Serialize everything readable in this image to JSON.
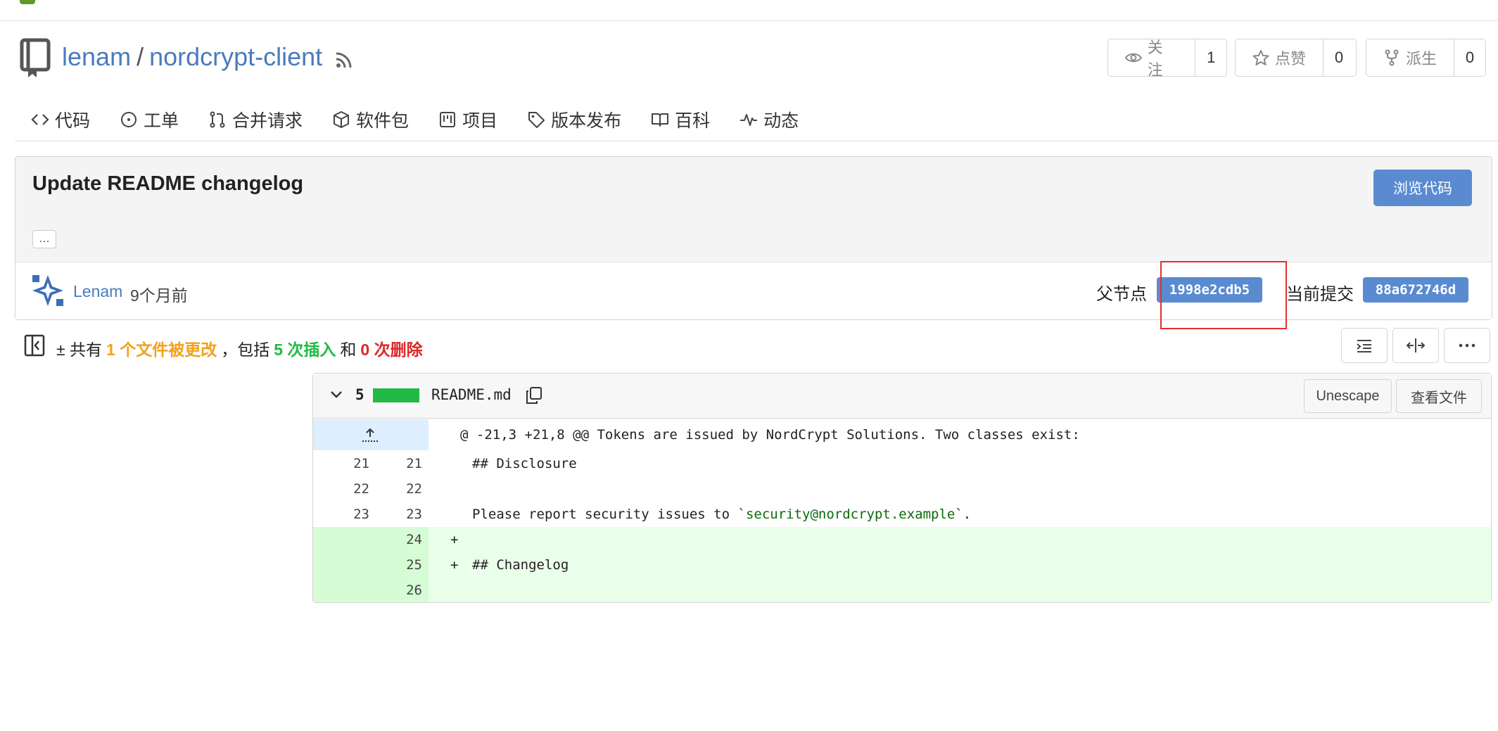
{
  "repo": {
    "owner": "lenam",
    "separator": "/",
    "name": "nordcrypt-client",
    "watch_label": "关注",
    "watch_count": "1",
    "star_label": "点赞",
    "star_count": "0",
    "fork_label": "派生",
    "fork_count": "0"
  },
  "tabs": [
    {
      "label": "代码",
      "icon": "code-icon"
    },
    {
      "label": "工单",
      "icon": "issue-icon"
    },
    {
      "label": "合并请求",
      "icon": "pull-request-icon"
    },
    {
      "label": "软件包",
      "icon": "package-icon"
    },
    {
      "label": "项目",
      "icon": "project-icon"
    },
    {
      "label": "版本发布",
      "icon": "tag-icon"
    },
    {
      "label": "百科",
      "icon": "book-icon"
    },
    {
      "label": "动态",
      "icon": "pulse-icon"
    }
  ],
  "commit": {
    "title": "Update README changelog",
    "browse_label": "浏览代码",
    "ellipsis": "…",
    "author": "Lenam",
    "ago": "9个月前",
    "parent_label": "父节点",
    "parent_sha": "1998e2cdb5",
    "current_label": "当前提交",
    "current_sha": "88a672746d"
  },
  "stats": {
    "prefix": "± 共有",
    "changed": "1 个文件被更改",
    "comma": "，包括",
    "additions": "5 次插入",
    "and": "和",
    "deletions": "0 次删除"
  },
  "file": {
    "change_count": "5",
    "name": "README.md",
    "unescape_label": "Unescape",
    "view_label": "查看文件",
    "hunk": "@ -21,3 +21,8 @@ Tokens are issued by NordCrypt Solutions. Two classes exist:",
    "lines": [
      {
        "old": "21",
        "new": "21",
        "sign": "",
        "code": "## Disclosure"
      },
      {
        "old": "22",
        "new": "22",
        "sign": "",
        "code": ""
      },
      {
        "old": "23",
        "new": "23",
        "sign": "",
        "code_pre": "Please report security issues to `",
        "code_str": "security@nordcrypt.example",
        "code_post": "`."
      },
      {
        "old": "",
        "new": "24",
        "sign": "+",
        "code": ""
      },
      {
        "old": "",
        "new": "25",
        "sign": "+",
        "code": "## Changelog"
      },
      {
        "old": "",
        "new": "26",
        "sign": "",
        "code": ""
      }
    ]
  },
  "colors": {
    "link": "#4a7bbd",
    "primary_button": "#5a8bd0",
    "added_bg": "#eaffea",
    "changed": "#f2a11c",
    "additions": "#21ba45",
    "deletions": "#db2828"
  }
}
